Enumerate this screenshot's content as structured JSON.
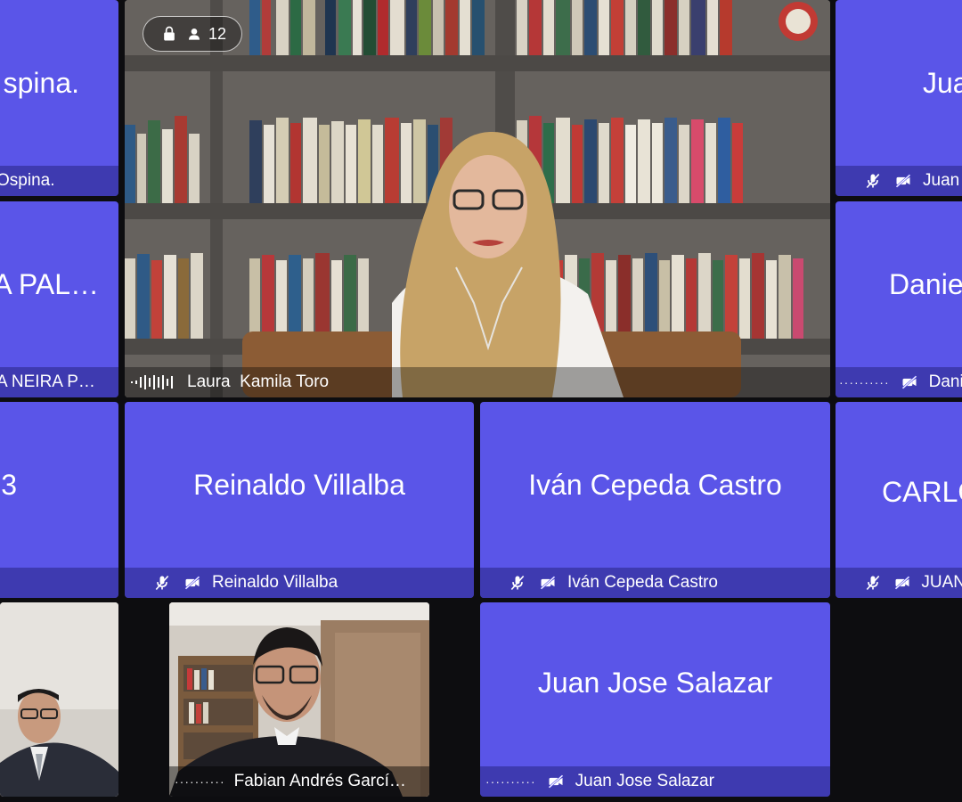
{
  "meeting": {
    "participant_count": "12"
  },
  "active_speaker": {
    "name": "Laura  Kamila Toro"
  },
  "tiles": {
    "r1_left_big": "spina.",
    "r1_left_bar": "Ospina.",
    "r1_right_big": "Jua",
    "r1_right_bar": "Juan",
    "r2_left_big": "A PAL…",
    "r2_left_bar": "A NEIRA P…",
    "r2_right_big": "Danie",
    "r2_right_bar": "Dani",
    "r3_left_big": "3",
    "r3_reinaldo_big": "Reinaldo Villalba",
    "r3_reinaldo_bar": "Reinaldo Villalba",
    "r3_ivan_big": "Iván Cepeda Castro",
    "r3_ivan_bar": "Iván Cepeda Castro",
    "r3_right_big": "CARLO",
    "r3_right_bar": "JUAN",
    "r4_fabian_bar": "Fabian Andrés Garcí…",
    "r4_juanjose_big": "Juan Jose Salazar",
    "r4_juanjose_bar": "Juan Jose Salazar"
  },
  "colors": {
    "tile": "#5a55e8",
    "background": "#0d0d10"
  },
  "icons": {
    "muted_mic": "mic-off-icon",
    "video_off": "video-off-icon",
    "lock": "lock-icon",
    "people": "person-icon",
    "audio_wave": "audio-wave-icon"
  }
}
